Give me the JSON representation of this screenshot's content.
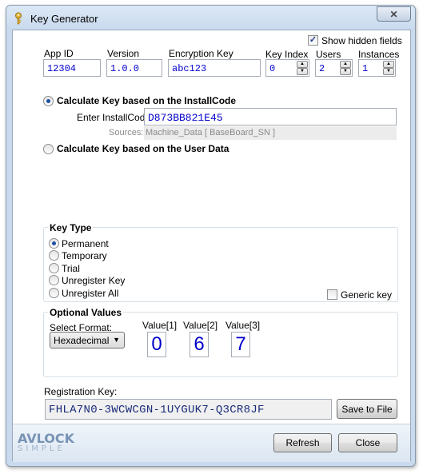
{
  "window": {
    "title": "Key Generator",
    "close_glyph": "✕"
  },
  "show_hidden": {
    "label": "Show hidden fields",
    "checked": true
  },
  "fields": {
    "app_id": {
      "label": "App ID",
      "value": "12304"
    },
    "version": {
      "label": "Version",
      "value": "1.0.0"
    },
    "encryption_key": {
      "label": "Encryption Key",
      "value": "abc123"
    },
    "key_index": {
      "label": "Key Index",
      "value": "0"
    },
    "users": {
      "label": "Users",
      "value": "2"
    },
    "instances": {
      "label": "Instances",
      "value": "1"
    }
  },
  "mode": {
    "install_code_label": "Calculate Key based on the InstallCode",
    "user_data_label": "Calculate Key based on the User Data",
    "selected": "install_code"
  },
  "install_code": {
    "label": "Enter InstallCode:",
    "value": "D873BB821E45",
    "sources_label": "Sources:",
    "sources_value": "Machine_Data [ BaseBoard_SN ]"
  },
  "key_type": {
    "title": "Key Type",
    "options": [
      "Permanent",
      "Temporary",
      "Trial",
      "Unregister Key",
      "Unregister All"
    ],
    "selected": "Permanent",
    "generic_key_label": "Generic key",
    "generic_key_checked": false
  },
  "optional_values": {
    "title": "Optional Values",
    "format_label": "Select Format:",
    "format_value": "Hexadecimal",
    "values": [
      {
        "label": "Value[1]",
        "value": "0"
      },
      {
        "label": "Value[2]",
        "value": "6"
      },
      {
        "label": "Value[3]",
        "value": "7"
      }
    ]
  },
  "registration": {
    "label": "Registration Key:",
    "value": "FHLA7N0-3WCWCGN-1UYGUK7-Q3CR8JF",
    "save_button": "Save to File"
  },
  "footer": {
    "logo_top": "AVLOCK",
    "logo_bottom": "SIMPLE",
    "refresh_button": "Refresh",
    "close_button": "Close"
  }
}
